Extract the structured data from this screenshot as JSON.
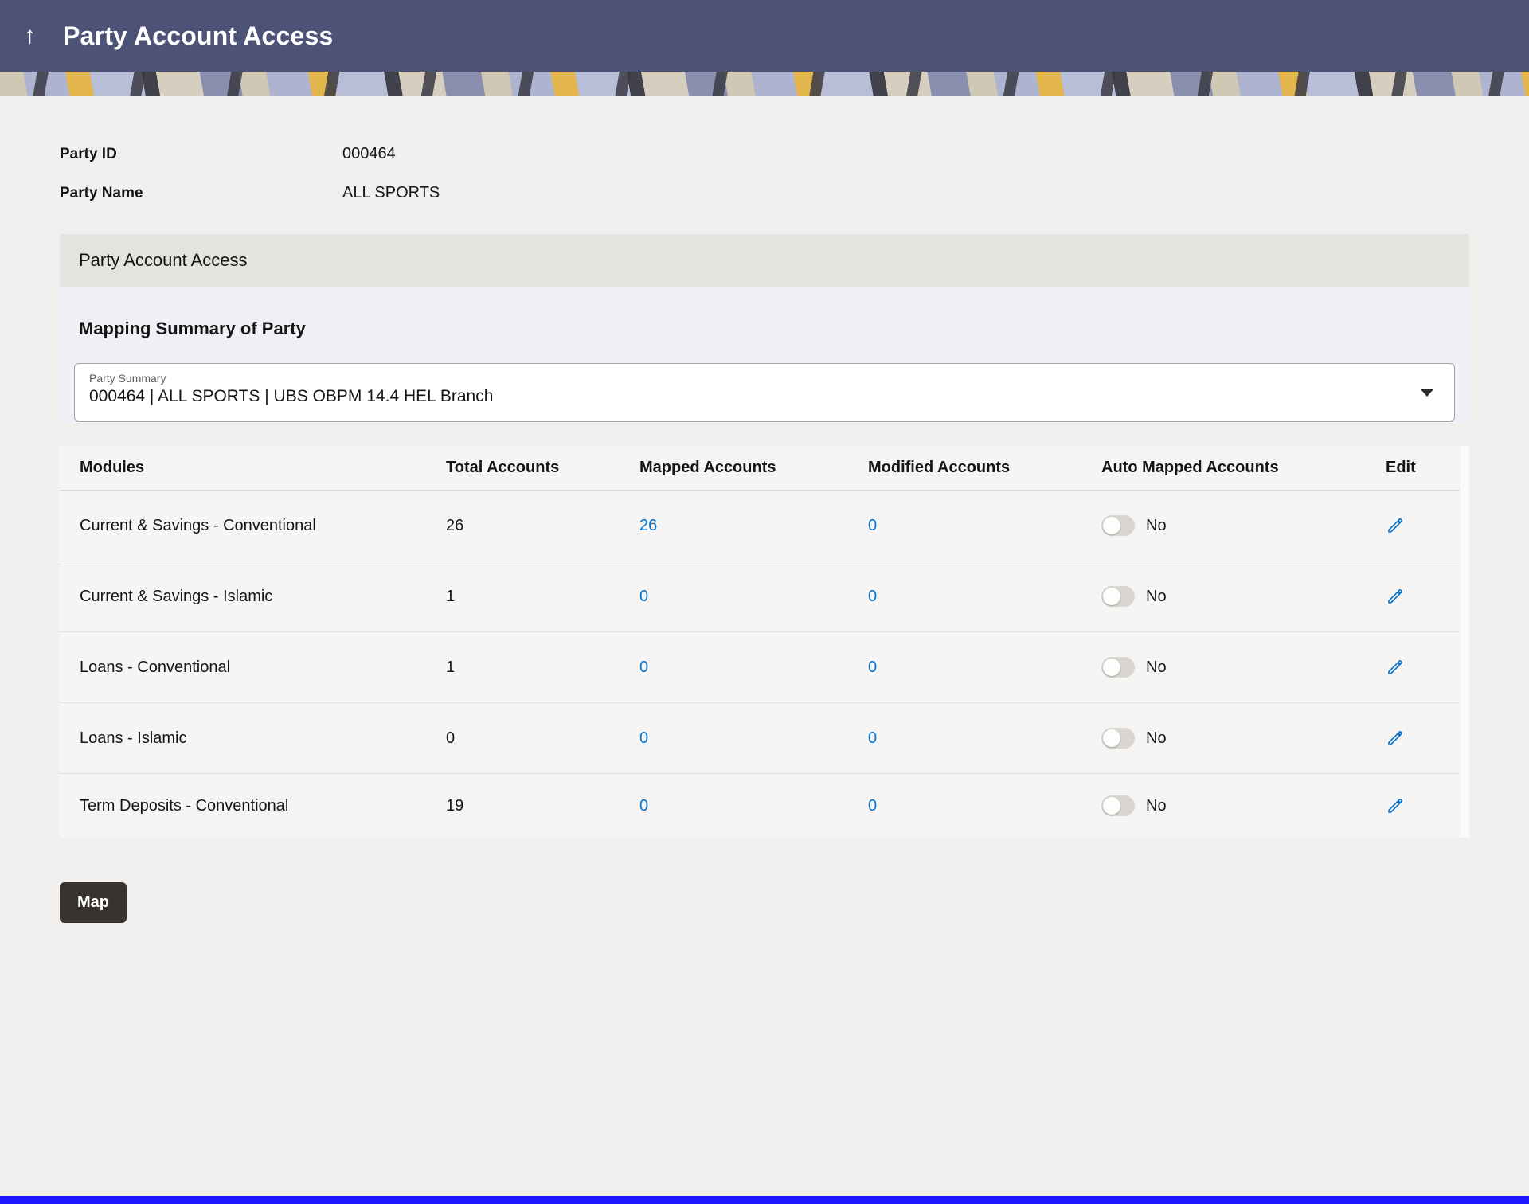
{
  "header": {
    "back_icon": "↑",
    "title": "Party Account Access"
  },
  "party_info": {
    "party_id_label": "Party ID",
    "party_id_value": "000464",
    "party_name_label": "Party Name",
    "party_name_value": "ALL SPORTS"
  },
  "panel": {
    "title": "Party Account Access",
    "section_title": "Mapping Summary of Party",
    "party_summary": {
      "label": "Party Summary",
      "value": "000464 | ALL SPORTS | UBS OBPM 14.4 HEL Branch"
    }
  },
  "table": {
    "columns": [
      "Modules",
      "Total Accounts",
      "Mapped Accounts",
      "Modified Accounts",
      "Auto Mapped Accounts",
      "Edit"
    ],
    "rows": [
      {
        "module": "Current & Savings - Conventional",
        "total": "26",
        "mapped": "26",
        "modified": "0",
        "auto_mapped": "No"
      },
      {
        "module": "Current & Savings - Islamic",
        "total": "1",
        "mapped": "0",
        "modified": "0",
        "auto_mapped": "No"
      },
      {
        "module": "Loans - Conventional",
        "total": "1",
        "mapped": "0",
        "modified": "0",
        "auto_mapped": "No"
      },
      {
        "module": "Loans - Islamic",
        "total": "0",
        "mapped": "0",
        "modified": "0",
        "auto_mapped": "No"
      },
      {
        "module": "Term Deposits - Conventional",
        "total": "19",
        "mapped": "0",
        "modified": "0",
        "auto_mapped": "No"
      }
    ]
  },
  "actions": {
    "map_label": "Map"
  },
  "colors": {
    "header_bg": "#4d5377",
    "link": "#0572ce",
    "button_bg": "#38332e",
    "bottom_bar": "#1b18ff",
    "mapping_section_bg": "#f1eef6"
  }
}
